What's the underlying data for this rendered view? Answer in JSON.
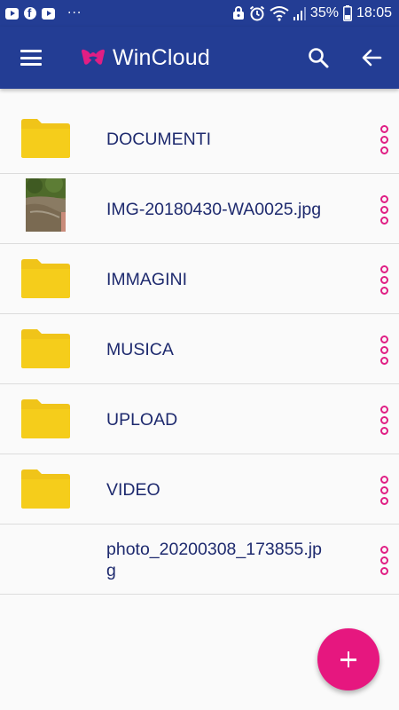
{
  "status_bar": {
    "battery_percent": "35%",
    "time": "18:05",
    "left_icons": [
      "youtube-icon",
      "facebook-icon",
      "youtube-icon"
    ],
    "more_indicator": "···"
  },
  "app_bar": {
    "title": "WinCloud",
    "brand_color": "#e01e84",
    "background": "#233d94"
  },
  "files": [
    {
      "name": "DOCUMENTI",
      "type": "folder"
    },
    {
      "name": "IMG-20180430-WA0025.jpg",
      "type": "image"
    },
    {
      "name": "IMMAGINI",
      "type": "folder"
    },
    {
      "name": "MUSICA",
      "type": "folder"
    },
    {
      "name": "UPLOAD",
      "type": "folder"
    },
    {
      "name": "VIDEO",
      "type": "folder"
    },
    {
      "name": "photo_20200308_173855.jpg",
      "type": "file"
    }
  ],
  "colors": {
    "folder": "#f5cd1b",
    "accent": "#e6177f",
    "text": "#1e2a6e"
  }
}
